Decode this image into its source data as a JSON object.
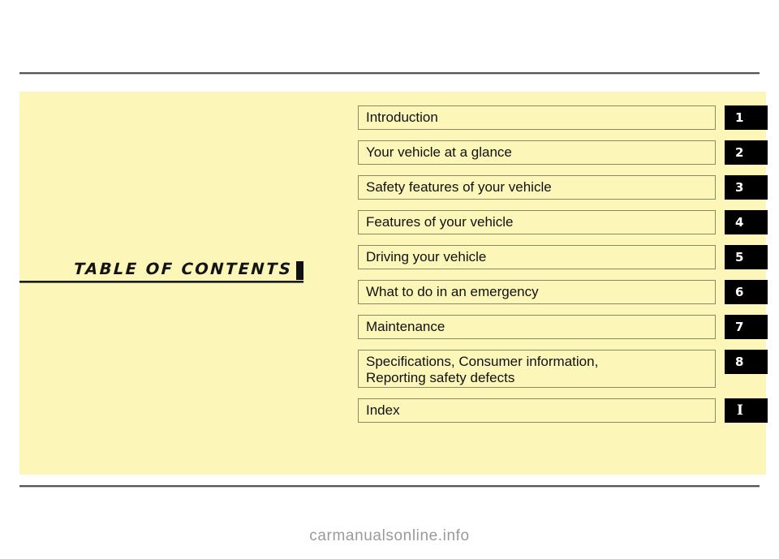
{
  "page": {
    "heading": "TABLE  OF  CONTENTS",
    "background_color": "#FFFFFF",
    "panel_color": "#FCF6B8",
    "tab_color": "#000000",
    "rule_color": "#555555"
  },
  "contents": {
    "rows": [
      {
        "label": "Introduction",
        "tab": "1",
        "tall": false
      },
      {
        "label": "Your vehicle at a glance",
        "tab": "2",
        "tall": false
      },
      {
        "label": "Safety features of your vehicle",
        "tab": "3",
        "tall": false
      },
      {
        "label": "Features of your vehicle",
        "tab": "4",
        "tall": false
      },
      {
        "label": "Driving your vehicle",
        "tab": "5",
        "tall": false
      },
      {
        "label": "What to do in an emergency",
        "tab": "6",
        "tall": false
      },
      {
        "label": "Maintenance",
        "tab": "7",
        "tall": false
      },
      {
        "label": "Specifications, Consumer information,\nReporting safety defects",
        "tab": "8",
        "tall": true
      },
      {
        "label": "Index",
        "tab": "I",
        "tall": false
      }
    ]
  },
  "watermark": {
    "text": "carmanualsonline.info"
  }
}
